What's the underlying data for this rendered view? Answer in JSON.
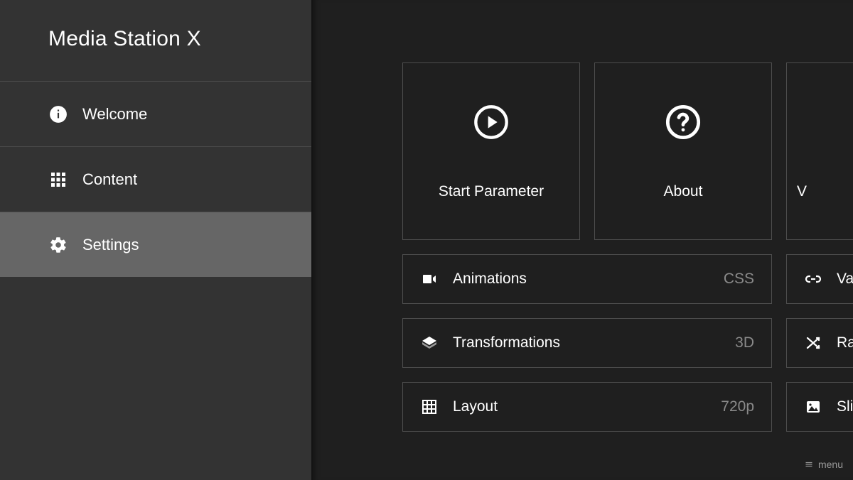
{
  "app_title": "Media Station X",
  "sidebar": {
    "items": [
      {
        "label": "Welcome",
        "icon": "info",
        "selected": false
      },
      {
        "label": "Content",
        "icon": "apps",
        "selected": false
      },
      {
        "label": "Settings",
        "icon": "gear",
        "selected": true
      }
    ]
  },
  "tiles": [
    {
      "label": "Start Parameter",
      "icon": "play"
    },
    {
      "label": "About",
      "icon": "help"
    },
    {
      "label": "V",
      "icon": "none"
    }
  ],
  "settings_left": [
    {
      "label": "Animations",
      "value": "CSS",
      "icon": "videocam"
    },
    {
      "label": "Transformations",
      "value": "3D",
      "icon": "layers"
    },
    {
      "label": "Layout",
      "value": "720p",
      "icon": "grid"
    }
  ],
  "settings_right": [
    {
      "label": "Va",
      "value": "",
      "icon": "link"
    },
    {
      "label": "Ra",
      "value": "",
      "icon": "shuffle"
    },
    {
      "label": "Sli",
      "value": "",
      "icon": "image"
    }
  ],
  "menu_hint": "menu"
}
